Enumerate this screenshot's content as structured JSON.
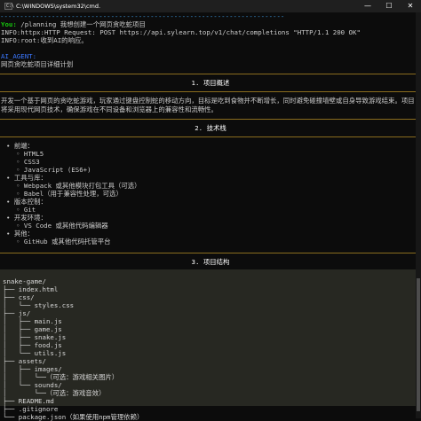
{
  "window": {
    "title": "C:\\WINDOWS\\system32\\cmd.",
    "icon_label": "C:\\",
    "controls": {
      "minimize": "—",
      "maximize": "☐",
      "close": "✕"
    }
  },
  "terminal": {
    "divider": "------------------------------------------------------------------------",
    "you_prefix": "You:",
    "you_text": " /planning 我想创建一个网页贪吃蛇项目",
    "info1": "INFO:httpx:HTTP Request: POST https://api.sylearn.top/v1/chat/completions \"HTTP/1.1 200 OK\"",
    "info2": "INFO:root:收到AI的响应。",
    "ai_label": "AI_AGENT:",
    "plan_title": "网页贪吃蛇项目详细计划"
  },
  "sections": {
    "overview": {
      "heading": "1. 项目概述",
      "body": "开发一个基于网页的贪吃蛇游戏，玩家通过键盘控制蛇的移动方向，目标是吃到食物并不断增长，同时避免碰撞墙壁或自身导致游戏结束。项目将采用现代网页技术，确保游戏在不同设备和浏览器上的兼容性和流畅性。"
    },
    "tech": {
      "heading": "2. 技术栈",
      "items": [
        {
          "label": "前端：",
          "children": [
            "HTML5",
            "CSS3",
            "JavaScript (ES6+)"
          ]
        },
        {
          "label": "工具与库：",
          "children": [
            "Webpack 或其他模块打包工具（可选）",
            "Babel（用于兼容性处理，可选）"
          ]
        },
        {
          "label": "版本控制：",
          "children": [
            "Git"
          ]
        },
        {
          "label": "开发环境：",
          "children": [
            "VS Code 或其他代码编辑器"
          ]
        },
        {
          "label": "其他：",
          "children": [
            "GitHub 或其他代码托管平台"
          ]
        }
      ]
    },
    "structure": {
      "heading": "3. 项目结构",
      "tree": [
        "snake-game/",
        "├── index.html",
        "├── css/",
        "│   └── styles.css",
        "├── js/",
        "│   ├── main.js",
        "│   ├── game.js",
        "│   ├── snake.js",
        "│   ├── food.js",
        "│   └── utils.js",
        "├── assets/",
        "│   ├── images/",
        "│   │   └──（可选：游戏相关图片）",
        "│   └── sounds/",
        "│       └──（可选：游戏音效）",
        "├── README.md",
        "├── .gitignore",
        "└── package.json（如果使用npm管理依赖）"
      ]
    }
  },
  "colors": {
    "background": "#0c0c0c",
    "titlebar": "#1f1f1f",
    "you_green": "#16c60c",
    "link_blue": "#3b78ff",
    "divider_gold": "#8a6d1e",
    "code_bg": "#272822"
  }
}
